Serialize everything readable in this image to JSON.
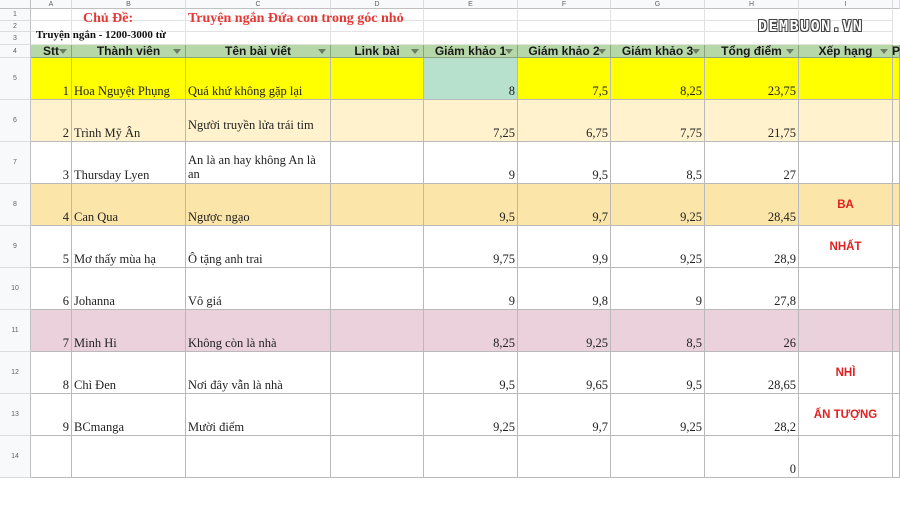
{
  "column_letters": [
    "A",
    "B",
    "C",
    "D",
    "E",
    "F",
    "G",
    "H",
    "I"
  ],
  "row_numbers": [
    "1",
    "2",
    "3",
    "4",
    "5",
    "6",
    "7",
    "8",
    "9",
    "10",
    "11",
    "12",
    "13",
    "14"
  ],
  "topic_label": "Chủ Đề:",
  "topic_value": "Truyện ngắn Đứa con trong góc nhỏ",
  "subtitle": "Truyện ngắn - 1200-3000 từ",
  "watermark": "DEMBUON.VN",
  "headers": [
    "Stt",
    "Thành viên",
    "Tên bài viết",
    "Link bài",
    "Giám khảo 1",
    "Giám khảo 2",
    "Giám khảo 3",
    "Tổng điểm",
    "Xếp hạng",
    "P"
  ],
  "rows": [
    {
      "stt": "1",
      "member": "Hoa Nguyệt Phụng",
      "title": "Quá khứ không gặp lại",
      "g1": "8",
      "g2": "7,5",
      "g3": "8,25",
      "total": "23,75",
      "rank": "",
      "bg": "#ffff00"
    },
    {
      "stt": "2",
      "member": "Trình Mỹ Ân",
      "title": "Người truyền lửa trái tim",
      "g1": "7,25",
      "g2": "6,75",
      "g3": "7,75",
      "total": "21,75",
      "rank": "",
      "bg": "#fff2cc"
    },
    {
      "stt": "3",
      "member": "Thursday Lyen",
      "title": "An là an hay không An là an",
      "g1": "9",
      "g2": "9,5",
      "g3": "8,5",
      "total": "27",
      "rank": "",
      "bg": "#ffffff"
    },
    {
      "stt": "4",
      "member": "Can Qua",
      "title": "Ngược ngạo",
      "g1": "9,5",
      "g2": "9,7",
      "g3": "9,25",
      "total": "28,45",
      "rank": "BA",
      "bg": "#fce5a8"
    },
    {
      "stt": "5",
      "member": "Mơ thấy mùa hạ",
      "title": "Ô tặng anh trai",
      "g1": "9,75",
      "g2": "9,9",
      "g3": "9,25",
      "total": "28,9",
      "rank": "NHẤT",
      "bg": "#ffffff"
    },
    {
      "stt": "6",
      "member": "Johanna",
      "title": "Vô giá",
      "g1": "9",
      "g2": "9,8",
      "g3": "9",
      "total": "27,8",
      "rank": "",
      "bg": "#ffffff"
    },
    {
      "stt": "7",
      "member": "Minh Hi",
      "title": "Không còn là nhà",
      "g1": "8,25",
      "g2": "9,25",
      "g3": "8,5",
      "total": "26",
      "rank": "",
      "bg": "#ead1dc"
    },
    {
      "stt": "8",
      "member": "Chì Đen",
      "title": "Nơi đây vẫn là nhà",
      "g1": "9,5",
      "g2": "9,65",
      "g3": "9,5",
      "total": "28,65",
      "rank": "NHÌ",
      "bg": "#ffffff"
    },
    {
      "stt": "9",
      "member": "BCmanga",
      "title": "Mười điểm",
      "g1": "9,25",
      "g2": "9,7",
      "g3": "9,25",
      "total": "28,2",
      "rank": "ẤN TƯỢNG",
      "bg": "#ffffff"
    },
    {
      "stt": "",
      "member": "",
      "title": "",
      "g1": "",
      "g2": "",
      "g3": "",
      "total": "0",
      "rank": "",
      "bg": "#ffffff"
    }
  ],
  "colors": {
    "header_green": "#b6d7a8",
    "topic_red": "#e53935",
    "rank_red": "#e02020",
    "selected_cell": "#b7e1cd"
  }
}
